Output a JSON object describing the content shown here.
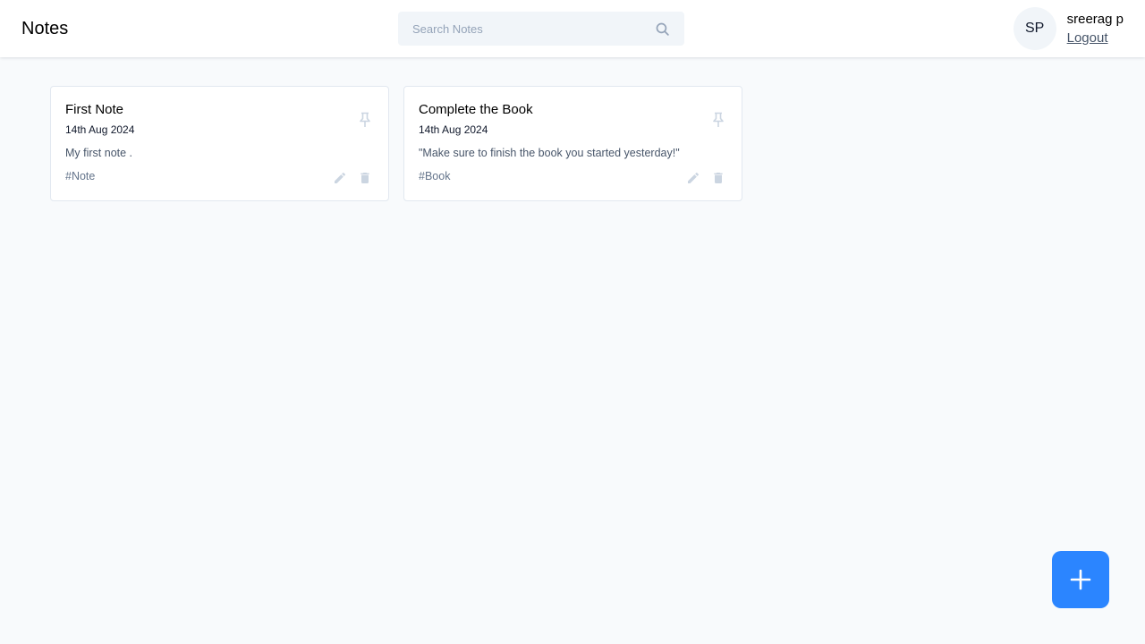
{
  "app": {
    "title": "Notes"
  },
  "search": {
    "placeholder": "Search Notes",
    "value": ""
  },
  "user": {
    "initials": "SP",
    "name": "sreerag p",
    "logout_label": "Logout"
  },
  "notes": [
    {
      "title": "First Note",
      "date": "14th Aug 2024",
      "content": "My first note .",
      "tags": "#Note"
    },
    {
      "title": "Complete the Book",
      "date": "14th Aug 2024",
      "content": "\"Make sure to finish the book you started yesterday!\"",
      "tags": "#Book"
    }
  ],
  "icons": {
    "search": "search-icon",
    "pin": "pin-icon",
    "edit": "pencil-icon",
    "delete": "trash-icon",
    "add": "plus-icon"
  },
  "colors": {
    "accent": "#2b85ff",
    "background": "#f8fafc",
    "icon_muted": "#cbd5e1"
  }
}
